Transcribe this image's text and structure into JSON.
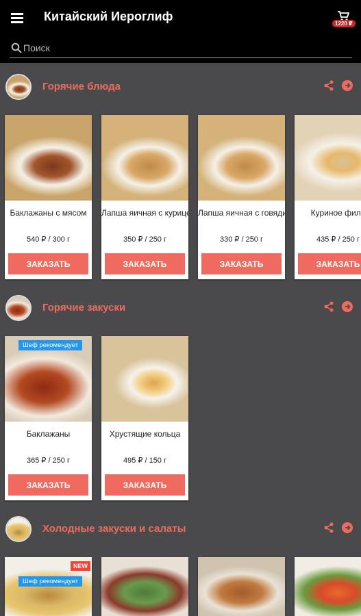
{
  "app": {
    "title": "Китайский Иероглиф",
    "cart_total": "1220 ₽"
  },
  "search": {
    "placeholder": "Поиск"
  },
  "colors": {
    "accent": "#f06b5f",
    "chef_badge": "#2196f3",
    "new_badge": "#f44336",
    "background": "#4a4a4c"
  },
  "icons": [
    "menu-icon",
    "cart-icon",
    "search-icon",
    "share-icon",
    "arrow-right-circle-icon"
  ],
  "sections": [
    {
      "title": "Горячие блюда",
      "items": [
        {
          "name": "Баклажаны с мясом",
          "price": "540 ₽ / 300 г",
          "button": "ЗАКАЗАТЬ"
        },
        {
          "name": "Лапша яичная с курицей",
          "price": "350 ₽ / 250 г",
          "button": "ЗАКАЗАТЬ"
        },
        {
          "name": "Лапша яичная с говядиной",
          "price": "330 ₽ / 250 г",
          "button": "ЗАКАЗАТЬ"
        },
        {
          "name": "Куриное филе",
          "price": "435 ₽ / 250 г",
          "button": "ЗАКАЗАТЬ"
        }
      ]
    },
    {
      "title": "Горячие закуски",
      "items": [
        {
          "name": "Баклажаны",
          "price": "365 ₽ / 250 г",
          "button": "ЗАКАЗАТЬ",
          "badge": "Шеф рекомендует"
        },
        {
          "name": "Хрустящие кольца",
          "price": "495 ₽ / 150 г",
          "button": "ЗАКАЗАТЬ"
        }
      ]
    },
    {
      "title": "Холодные закуски и салаты",
      "items": [
        {
          "badge": "Шеф рекомендует",
          "badge_new": "NEW"
        }
      ]
    }
  ]
}
